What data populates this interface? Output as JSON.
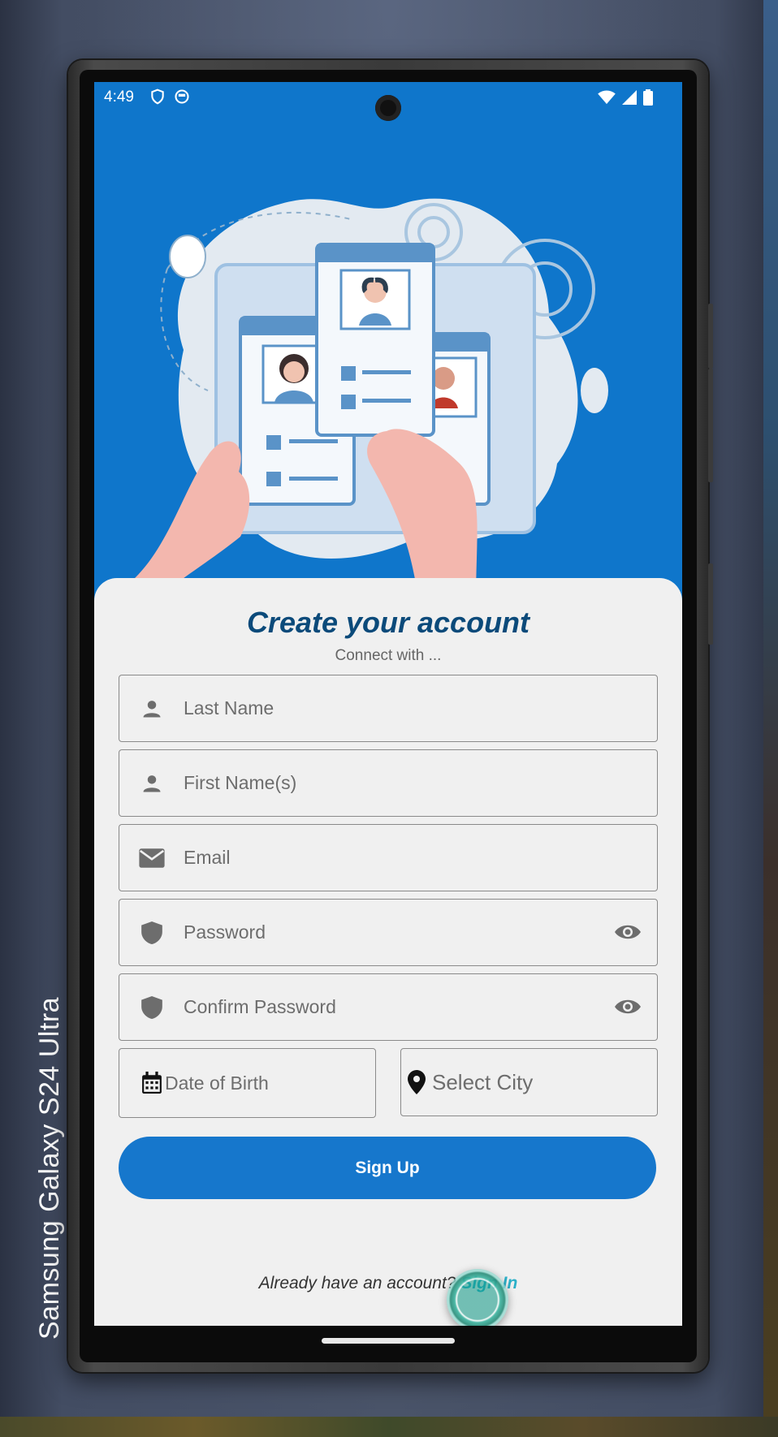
{
  "device": {
    "label": "Samsung Galaxy  S24 Ultra"
  },
  "status_bar": {
    "time": "4:49",
    "left_icons": [
      "shield-icon",
      "face-icon"
    ],
    "right_icons": [
      "wifi-icon",
      "signal-icon",
      "battery-icon"
    ]
  },
  "hero": {
    "illustration": "profile-cards-illustration"
  },
  "form": {
    "title": "Create your account",
    "subtitle": "Connect with ...",
    "fields": {
      "last_name": {
        "placeholder": "Last Name",
        "icon": "person-icon"
      },
      "first_name": {
        "placeholder": "First Name(s)",
        "icon": "person-icon"
      },
      "email": {
        "placeholder": "Email",
        "icon": "mail-icon"
      },
      "password": {
        "placeholder": "Password",
        "icon": "shield-icon",
        "toggle": "eye-icon"
      },
      "confirm_password": {
        "placeholder": "Confirm Password",
        "icon": "shield-icon",
        "toggle": "eye-icon"
      },
      "date_of_birth": {
        "placeholder": "Date of Birth",
        "icon": "calendar-icon"
      },
      "city": {
        "placeholder": "Select City",
        "icon": "location-pin-icon"
      }
    },
    "submit_label": "Sign Up",
    "footer": {
      "question": "Already have an account?",
      "link": "Sign In"
    }
  },
  "colors": {
    "primary": "#1677cc",
    "hero_bg": "#0f76cb",
    "title": "#0b4a7a",
    "link": "#2bb0c8"
  }
}
